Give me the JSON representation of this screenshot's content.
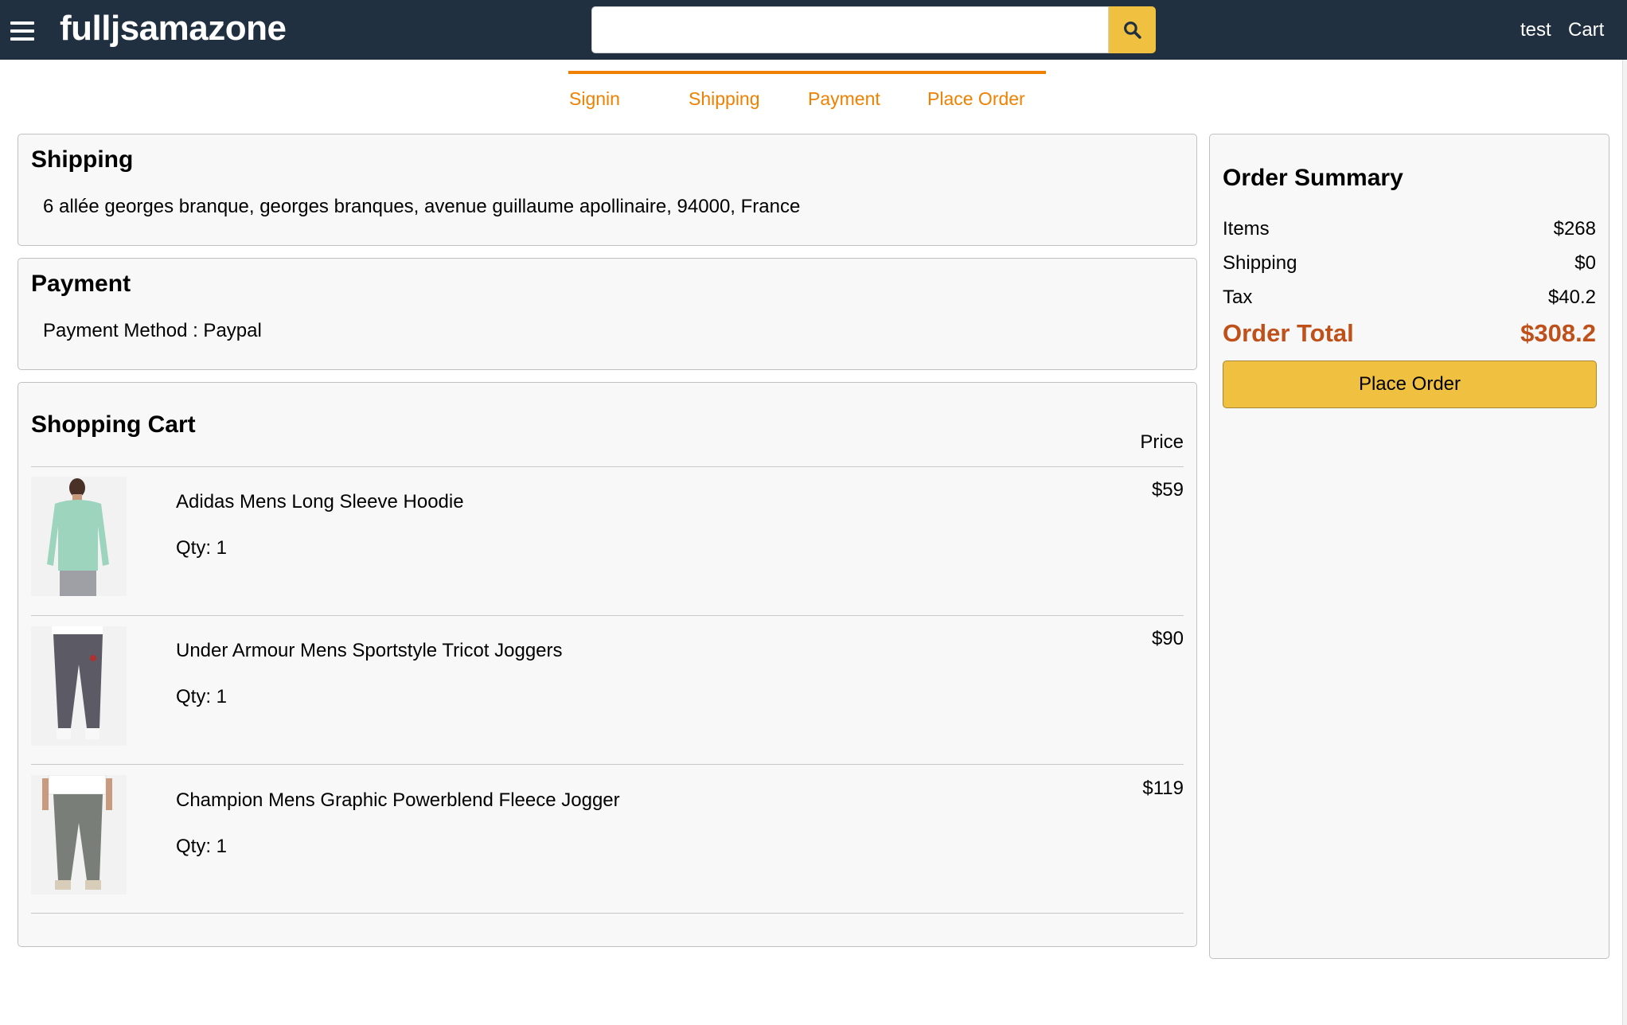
{
  "header": {
    "brand": "fulljsamazone",
    "search_value": "",
    "search_placeholder": "",
    "user": "test",
    "cart": "Cart"
  },
  "steps": [
    "Signin",
    "Shipping",
    "Payment",
    "Place Order"
  ],
  "shipping": {
    "title": "Shipping",
    "address": "6 allée georges branque, georges branques, avenue guillaume apollinaire, 94000, France"
  },
  "payment": {
    "title": "Payment",
    "method": "Payment Method : Paypal"
  },
  "cart": {
    "title": "Shopping Cart",
    "price_header": "Price",
    "items": [
      {
        "name": "Adidas Mens Long Sleeve Hoodie",
        "qty": "Qty: 1",
        "price": "$59",
        "image": "mint-hoodie"
      },
      {
        "name": "Under Armour Mens Sportstyle Tricot Joggers",
        "qty": "Qty: 1",
        "price": "$90",
        "image": "grey-joggers"
      },
      {
        "name": "Champion Mens Graphic Powerblend Fleece Jogger",
        "qty": "Qty: 1",
        "price": "$119",
        "image": "grey-fleece-jogger"
      }
    ]
  },
  "summary": {
    "title": "Order Summary",
    "items_label": "Items",
    "items_value": "$268",
    "shipping_label": "Shipping",
    "shipping_value": "$0",
    "tax_label": "Tax",
    "tax_value": "$40.2",
    "total_label": "Order Total",
    "total_value": "$308.2",
    "place_order": "Place Order"
  },
  "colors": {
    "header_bg": "#203040",
    "accent": "#f0c040",
    "step_active": "#f08000",
    "total": "#c0501a"
  }
}
